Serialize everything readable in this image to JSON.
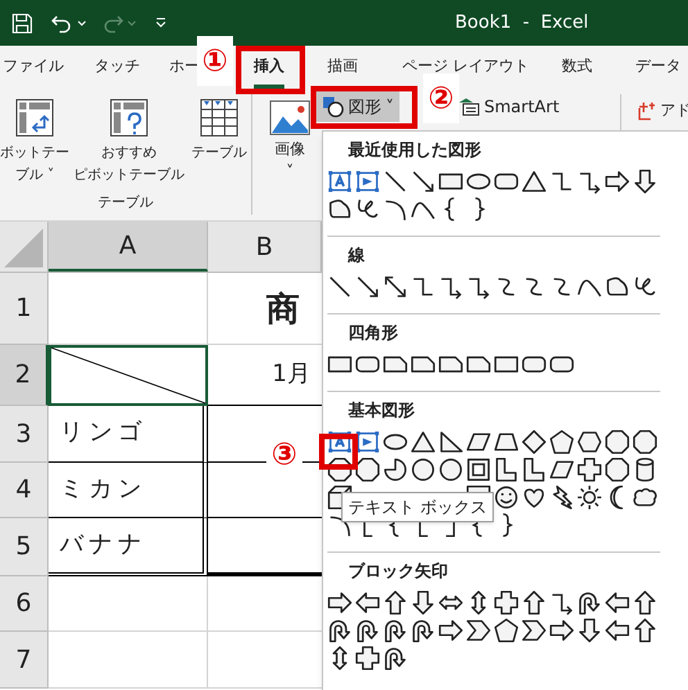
{
  "titlebar": {
    "title": "Book1  -  Excel"
  },
  "tabs": [
    {
      "label": "ファイル",
      "selected": false
    },
    {
      "label": "タッチ",
      "selected": false
    },
    {
      "label": "ホー",
      "selected": false
    },
    {
      "label": "挿入",
      "selected": true
    },
    {
      "label": "描画",
      "selected": false
    },
    {
      "label": "ページ レイアウト",
      "selected": false
    },
    {
      "label": "数式",
      "selected": false
    },
    {
      "label": "データ",
      "selected": false
    }
  ],
  "ribbon": {
    "table_group": {
      "label": "テーブル",
      "buttons": [
        {
          "lines": [
            "ボットテー",
            "ブル ˅"
          ]
        },
        {
          "lines": [
            "おすすめ",
            "ピボットテーブル"
          ]
        },
        {
          "lines": [
            "テーブル"
          ]
        }
      ]
    },
    "image_button": {
      "label": "画像",
      "caret": "˅"
    },
    "shapes_button": {
      "label": "図形",
      "caret": "˅",
      "pressed": true
    },
    "smartart_button": {
      "label": "SmartArt"
    },
    "addin_button": {
      "label": "アド"
    }
  },
  "sheet": {
    "columns": [
      {
        "label": "A",
        "selected": true
      },
      {
        "label": "B",
        "selected": false
      }
    ],
    "rows": [
      {
        "header": "1",
        "kind": "title",
        "selected": false,
        "b": "商"
      },
      {
        "header": "2",
        "kind": "table-header",
        "selected": true,
        "b": "1月"
      },
      {
        "header": "3",
        "kind": "item",
        "selected": false,
        "a": "リンゴ"
      },
      {
        "header": "4",
        "kind": "item",
        "selected": false,
        "a": "ミカン"
      },
      {
        "header": "5",
        "kind": "item",
        "selected": false,
        "a": "バナナ"
      },
      {
        "header": "6",
        "kind": "empty",
        "selected": false
      },
      {
        "header": "7",
        "kind": "empty",
        "selected": false
      }
    ]
  },
  "shapes_menu": {
    "sections": [
      {
        "title": "最近使用した図形"
      },
      {
        "title": "線"
      },
      {
        "title": "四角形"
      },
      {
        "title": "基本図形"
      },
      {
        "title": "ブロック矢印"
      }
    ],
    "tooltip": "テキスト ボックス"
  },
  "callouts": [
    {
      "label": "①"
    },
    {
      "label": "②"
    },
    {
      "label": "③"
    }
  ]
}
